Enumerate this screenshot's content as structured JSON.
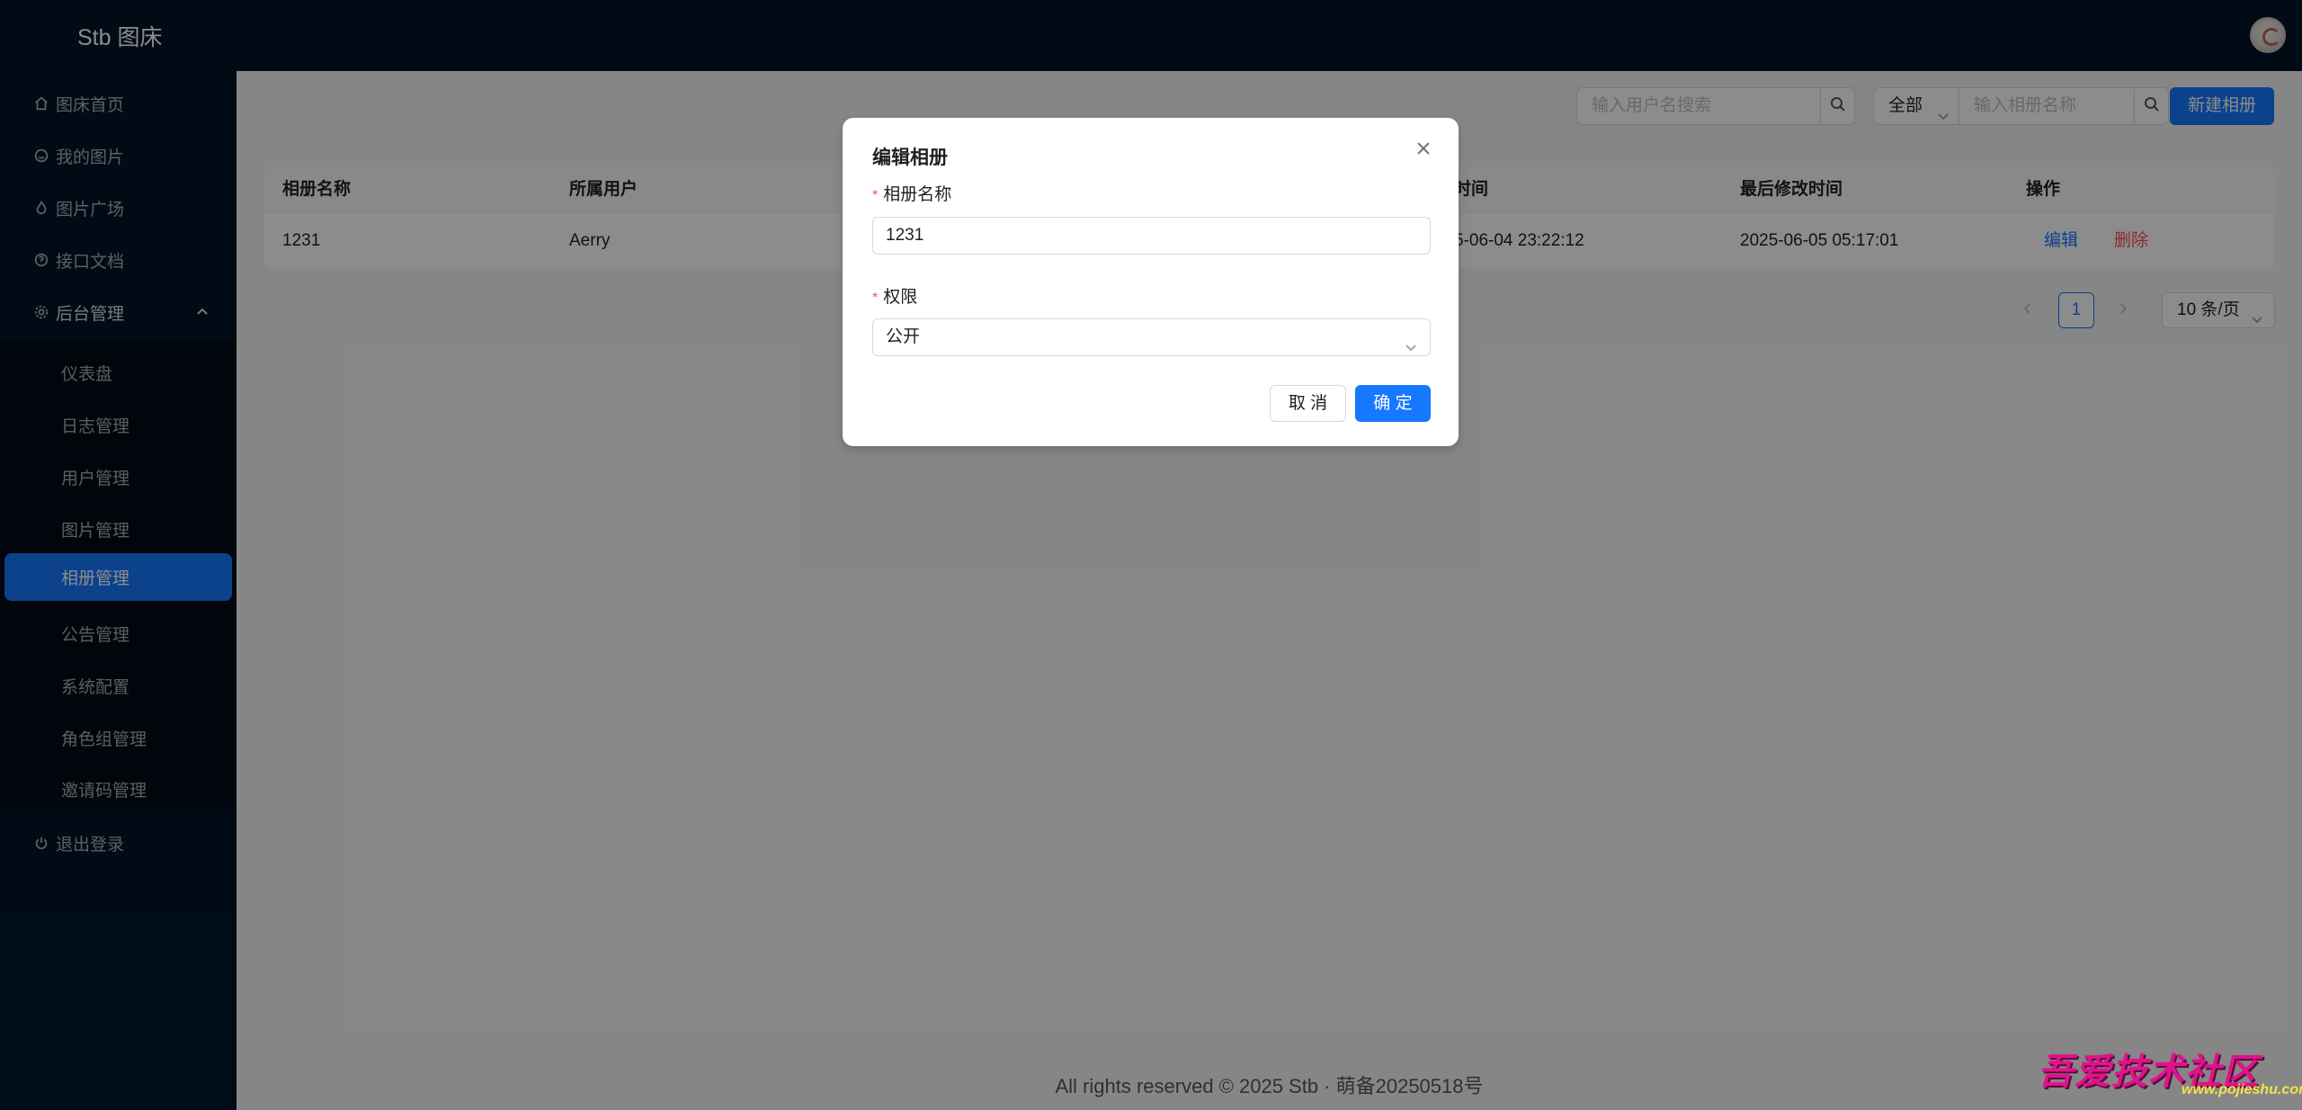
{
  "header": {
    "brand": "Stb 图床"
  },
  "sidebar": {
    "items": [
      {
        "label": "图床首页",
        "icon": "home-icon"
      },
      {
        "label": "我的图片",
        "icon": "smile-icon"
      },
      {
        "label": "图片广场",
        "icon": "fire-icon"
      },
      {
        "label": "接口文档",
        "icon": "question-icon"
      },
      {
        "label": "后台管理",
        "icon": "setting-icon"
      }
    ],
    "submenu": [
      {
        "label": "仪表盘"
      },
      {
        "label": "日志管理"
      },
      {
        "label": "用户管理"
      },
      {
        "label": "图片管理"
      },
      {
        "label": "相册管理",
        "active": true
      },
      {
        "label": "公告管理"
      },
      {
        "label": "系统配置"
      },
      {
        "label": "角色组管理"
      },
      {
        "label": "邀请码管理"
      }
    ],
    "logout": {
      "label": "退出登录",
      "icon": "power-icon"
    }
  },
  "toolbar": {
    "user_search_placeholder": "输入用户名搜索",
    "filter_value": "全部",
    "album_search_placeholder": "输入相册名称",
    "new_album_label": "新建相册"
  },
  "table": {
    "columns": [
      "相册名称",
      "所属用户",
      "时间",
      "最后修改时间",
      "操作"
    ],
    "rows": [
      {
        "name": "1231",
        "user": "Aerry",
        "created": "5-06-04 23:22:12",
        "modified": "2025-06-05 05:17:01",
        "edit": "编辑",
        "delete": "删除"
      }
    ]
  },
  "pagination": {
    "current": "1",
    "page_size": "10 条/页"
  },
  "footer": {
    "text": "All rights reserved © 2025 Stb · 萌备20250518号"
  },
  "modal": {
    "title": "编辑相册",
    "name_label": "相册名称",
    "name_value": "1231",
    "permission_label": "权限",
    "permission_value": "公开",
    "required_mark": "*",
    "cancel_label": "取 消",
    "ok_label": "确 定"
  },
  "watermark": {
    "title": "吾爱技术社区",
    "url": "www.pojieshu.com"
  },
  "colors": {
    "primary": "#1677ff",
    "danger": "#ff4d4f",
    "dark": "#001529"
  }
}
